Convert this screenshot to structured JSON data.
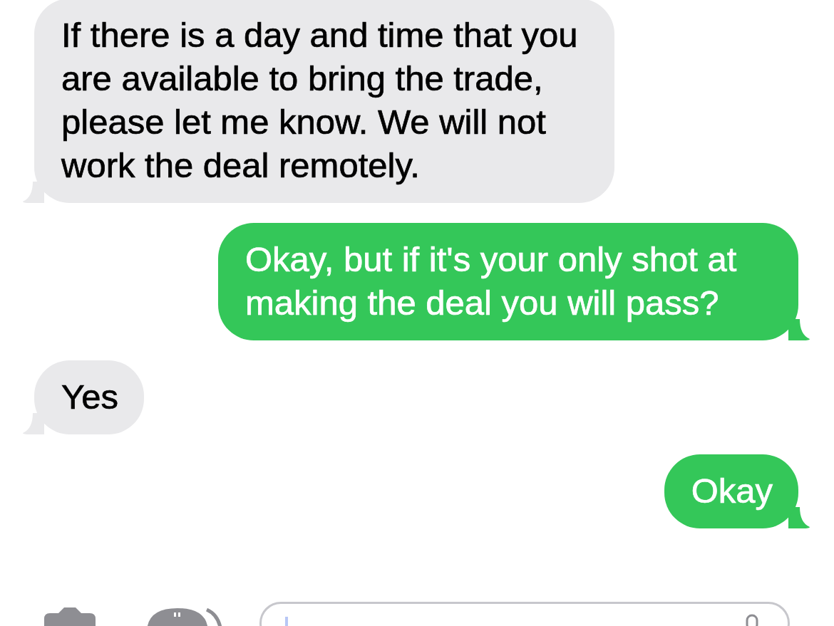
{
  "messages": [
    {
      "kind": "received",
      "text": "If there is a day and time that you are available to bring the trade, please let me know. We will not work the deal remotely."
    },
    {
      "kind": "sent",
      "text": "Okay, but if it's your only shot at making the deal you will pass?"
    },
    {
      "kind": "received",
      "text": "Yes"
    },
    {
      "kind": "sent",
      "text": "Okay"
    }
  ]
}
